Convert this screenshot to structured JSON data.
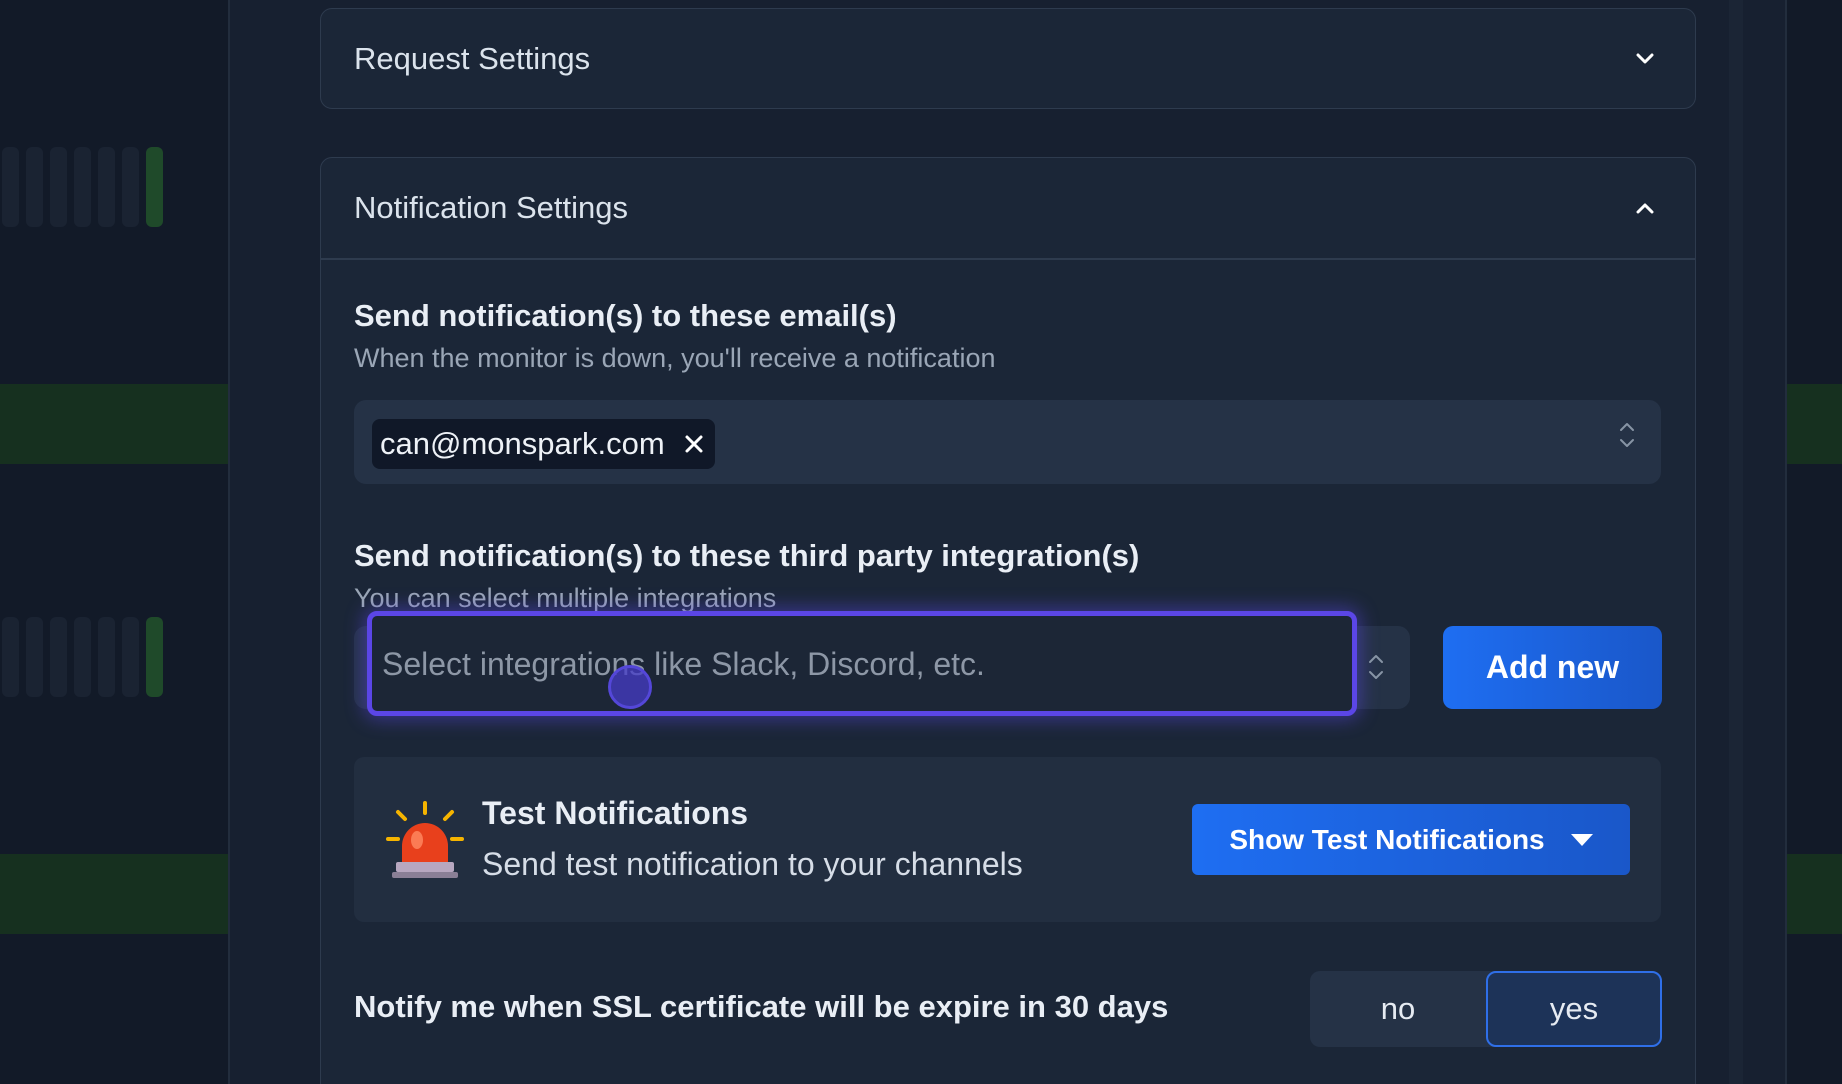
{
  "request_settings": {
    "title": "Request Settings"
  },
  "notification_settings": {
    "title": "Notification Settings",
    "email": {
      "label": "Send notification(s) to these email(s)",
      "help": "When the monitor is down, you'll receive a notification",
      "selected": [
        "can@monspark.com"
      ]
    },
    "integrations": {
      "label": "Send notification(s) to these third party integration(s)",
      "help": "You can select multiple integrations",
      "placeholder": "Select integrations like Slack, Discord, etc.",
      "add_new_label": "Add new"
    },
    "test": {
      "title": "Test Notifications",
      "subtitle": "Send test notification to your channels",
      "button_label": "Show Test Notifications",
      "icon": "siren-icon"
    },
    "ssl": {
      "label": "Notify me when SSL certificate will be expire in 30 days",
      "options": [
        "no",
        "yes"
      ],
      "selected": "yes"
    }
  },
  "colors": {
    "accent": "#1e6ef2",
    "focus_ring": "#5b46e6",
    "background": "#172030"
  }
}
